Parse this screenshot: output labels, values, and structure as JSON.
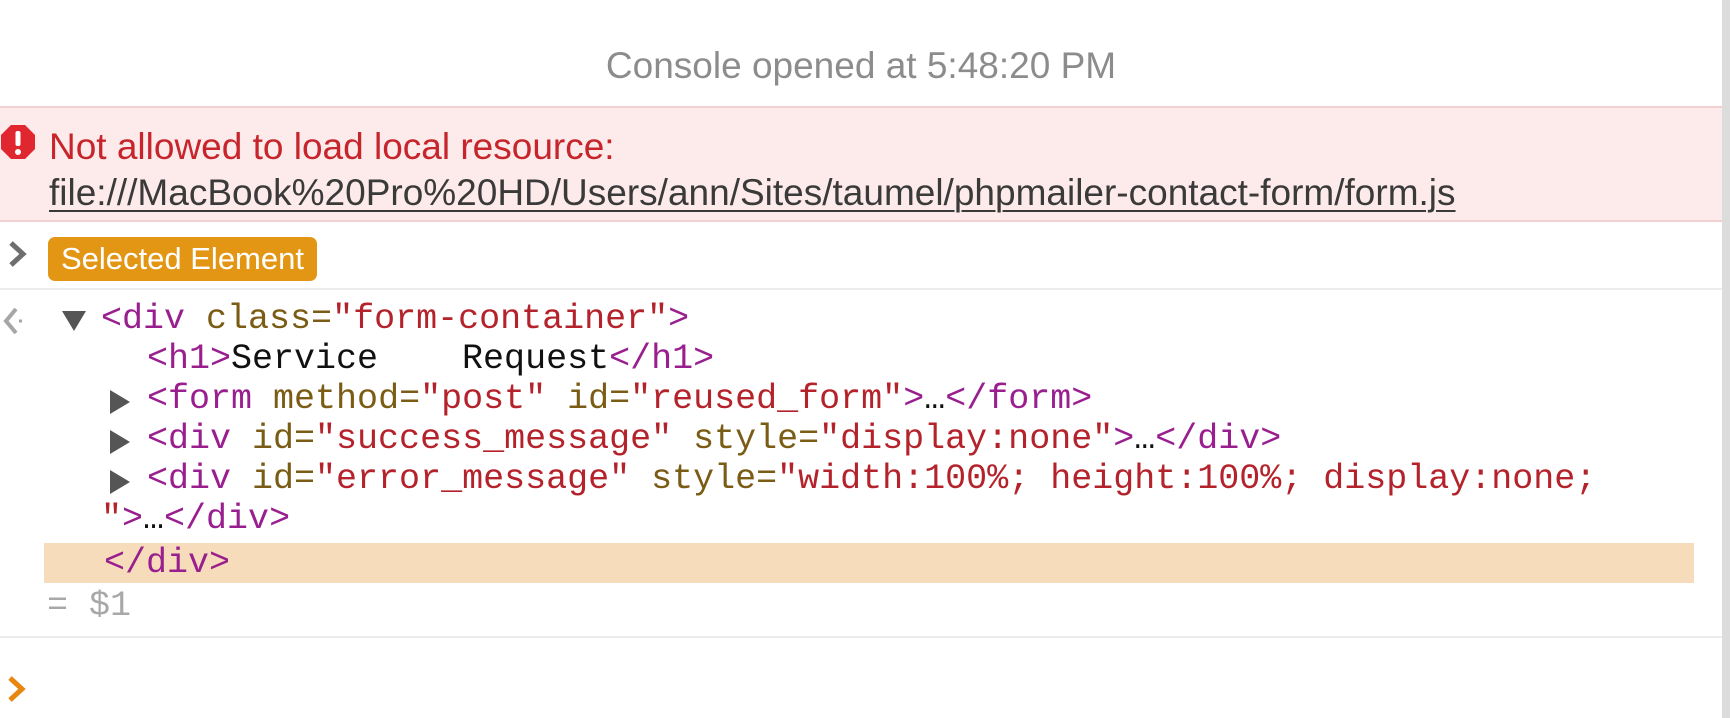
{
  "console": {
    "timestamp_text": "Console opened at 5:48:20 PM"
  },
  "error": {
    "icon": "error-exclamation-icon",
    "message": "Not allowed to load local resource:",
    "resource_url": "file:///MacBook%20Pro%20HD/Users/ann/Sites/taumel/phpmailer-contact-form/form.js"
  },
  "input_entry": {
    "badge_label": "Selected Element"
  },
  "result": {
    "lines": [
      {
        "open_tag": "<div",
        "attr1": "class=",
        "val1": "\"form-container\"",
        "close": ">"
      },
      {
        "open_tag": "<h1>",
        "text": "Service    Request",
        "close_tag": "</h1>"
      },
      {
        "open_tag": "<form",
        "attr1": "method=",
        "val1": "\"post\"",
        "attr2": "id=",
        "val2": "\"reused_form\"",
        "gt": ">",
        "ellipsis": "…",
        "close_tag": "</form>"
      },
      {
        "open_tag": "<div",
        "attr1": "id=",
        "val1": "\"success_message\"",
        "attr2": "style=",
        "val2": "\"display:none\"",
        "gt": ">",
        "ellipsis": "…",
        "close_tag": "</div>"
      },
      {
        "open_tag": "<div",
        "attr1": "id=",
        "val1": "\"error_message\"",
        "attr2": "style=",
        "val2": "\"width:100%; height:100%; display:none;",
        "val2_end": "\"",
        "gt": ">",
        "ellipsis": "…",
        "close_tag": "</div>"
      },
      {
        "close_tag": "</div>"
      }
    ],
    "alias": "= $1"
  },
  "prompt": {
    "value": ""
  },
  "colors": {
    "error_bg": "#fdeaea",
    "error_text": "#c6252c",
    "badge_bg": "#e39614",
    "tag": "#991f8f",
    "attr_name": "#7a5c14",
    "attr_value": "#b4232b",
    "selection_bg": "#f6dcba",
    "prompt_chevron": "#e8870f"
  }
}
